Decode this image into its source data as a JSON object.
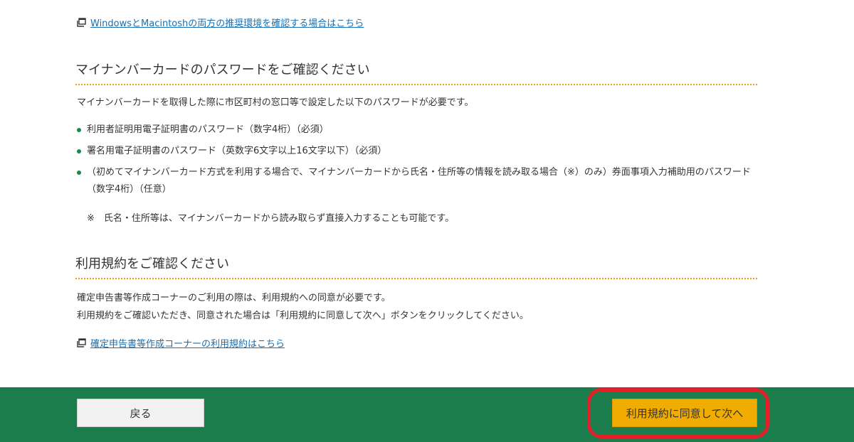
{
  "links": {
    "recommended_env": "WindowsとMacintoshの両方の推奨環境を確認する場合はこちら",
    "terms": "確定申告書等作成コーナーの利用規約はこちら"
  },
  "password_section": {
    "heading": "マイナンバーカードのパスワードをご確認ください",
    "intro": "マイナンバーカードを取得した際に市区町村の窓口等で設定した以下のパスワードが必要です。",
    "items": [
      "利用者証明用電子証明書のパスワード（数字4桁）（必須）",
      "署名用電子証明書のパスワード（英数字6文字以上16文字以下）（必須）",
      "（初めてマイナンバーカード方式を利用する場合で、マイナンバーカードから氏名・住所等の情報を読み取る場合（※）のみ）券面事項入力補助用のパスワード（数字4桁）（任意）"
    ],
    "note": "※　氏名・住所等は、マイナンバーカードから読み取らず直接入力することも可能です。"
  },
  "terms_section": {
    "heading": "利用規約をご確認ください",
    "line1": "確定申告書等作成コーナーのご利用の際は、利用規約への同意が必要です。",
    "line2": "利用規約をご確認いただき、同意された場合は「利用規約に同意して次へ」ボタンをクリックしてください。"
  },
  "footer": {
    "back_label": "戻る",
    "agree_label": "利用規約に同意して次へ"
  },
  "colors": {
    "footer_bg": "#1b7d4b",
    "accent_button": "#f0ac00",
    "link": "#1a6fb0",
    "bullet": "#1a8a4a",
    "heading_rule": "#e8a21a",
    "highlight": "#e3202a"
  },
  "icons": {
    "external_window": "external-window-icon"
  }
}
